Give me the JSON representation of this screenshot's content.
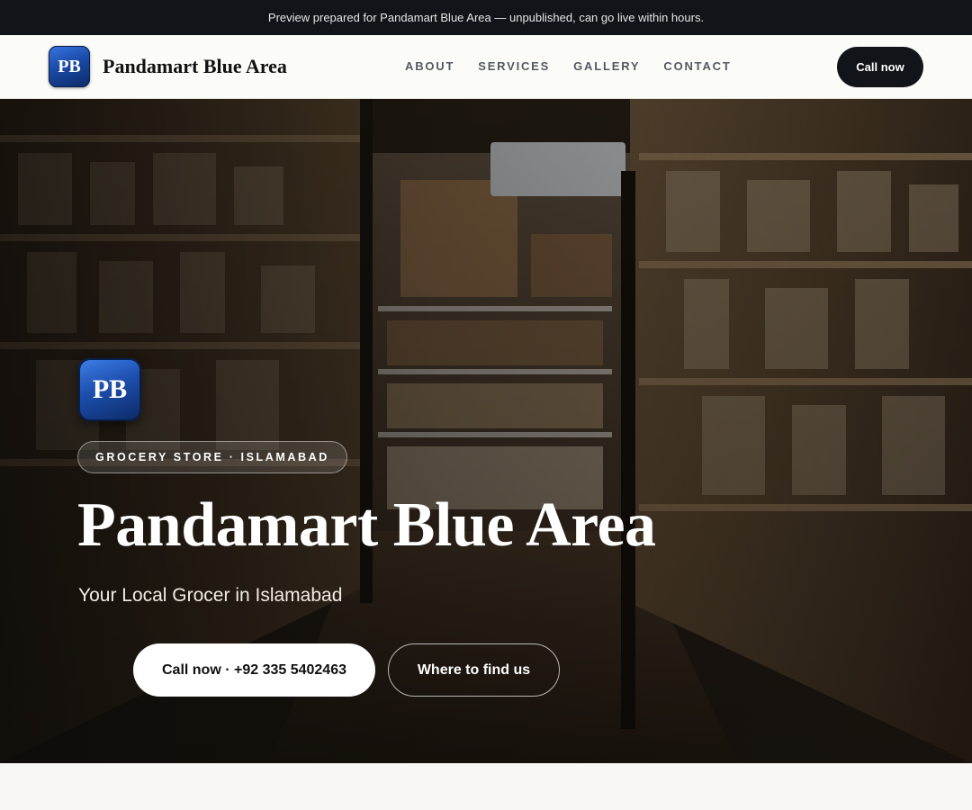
{
  "announcement": "Preview prepared for Pandamart Blue Area — unpublished, can go live within hours.",
  "brand": {
    "initials": "PB",
    "name": "Pandamart Blue Area"
  },
  "nav": {
    "items": [
      {
        "label": "ABOUT"
      },
      {
        "label": "SERVICES"
      },
      {
        "label": "GALLERY"
      },
      {
        "label": "CONTACT"
      }
    ],
    "cta_label": "Call now"
  },
  "hero": {
    "logo_initials": "PB",
    "badge": "GROCERY STORE · ISLAMABAD",
    "title": "Pandamart Blue Area",
    "subtitle": "Your Local Grocer in Islamabad",
    "primary_button": "Call now · +92 335 5402463",
    "secondary_button": "Where to find us",
    "background_image": "grocery-store-aisle-photo"
  },
  "colors": {
    "topbar": "#111418",
    "accent_dark": "#111418",
    "logo_blue": "#1a4aa8",
    "page_bg": "#f8f7f3"
  }
}
